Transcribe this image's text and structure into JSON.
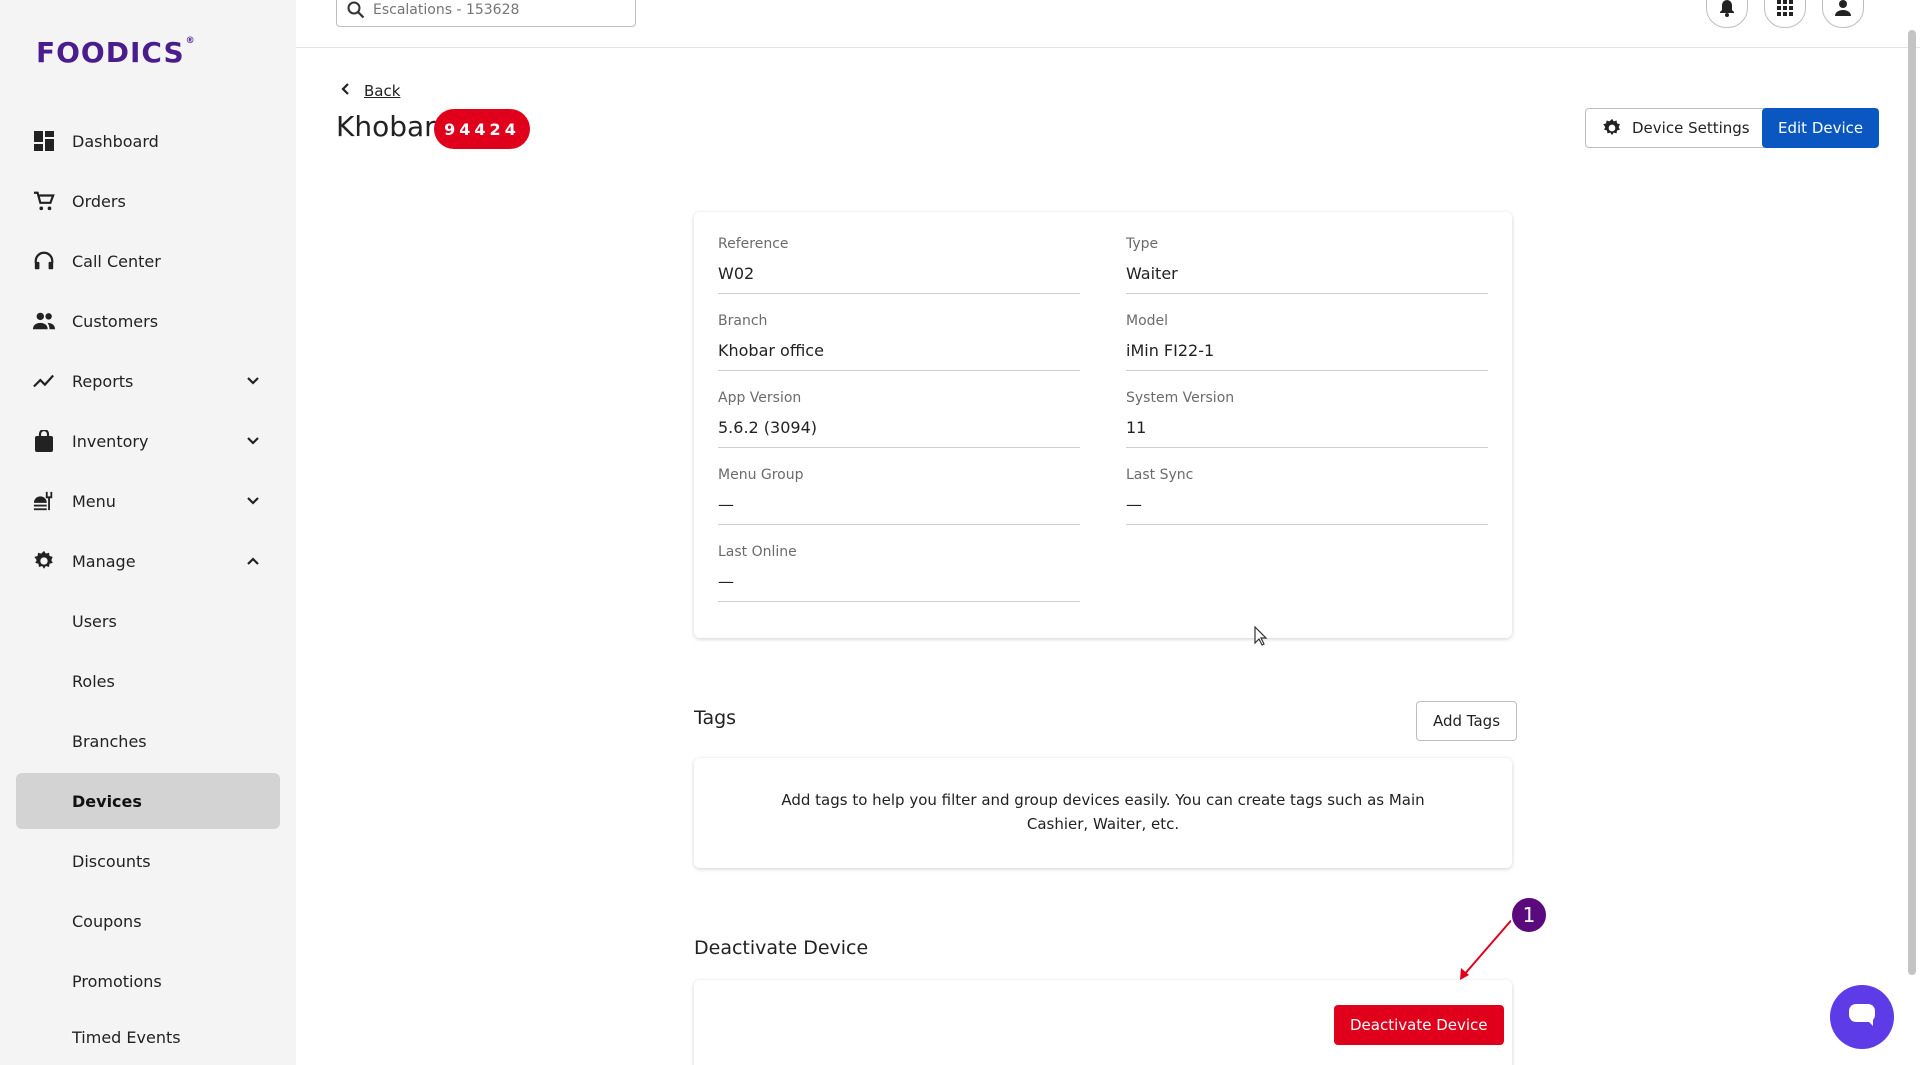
{
  "brand": {
    "logo": "FOODICS",
    "mark": "®",
    "color": "#4a1c8c"
  },
  "sidebar": {
    "items": [
      {
        "label": "Dashboard",
        "icon": "dashboard-icon"
      },
      {
        "label": "Orders",
        "icon": "cart-icon"
      },
      {
        "label": "Call Center",
        "icon": "headset-icon"
      },
      {
        "label": "Customers",
        "icon": "customers-icon"
      },
      {
        "label": "Reports",
        "icon": "reports-icon",
        "expandable": true
      },
      {
        "label": "Inventory",
        "icon": "inventory-icon",
        "expandable": true
      },
      {
        "label": "Menu",
        "icon": "menu-icon",
        "expandable": true
      },
      {
        "label": "Manage",
        "icon": "gear-icon",
        "expanded": true
      }
    ],
    "manage_items": [
      "Users",
      "Roles",
      "Branches",
      "Devices",
      "Discounts",
      "Coupons",
      "Promotions",
      "Timed Events"
    ],
    "active": "Devices"
  },
  "topbar": {
    "search_placeholder": "Escalations - 153628",
    "icons": [
      "bell-icon",
      "apps-grid-icon",
      "user-icon"
    ]
  },
  "header": {
    "back_label": "Back",
    "title": "Khobar",
    "reference_badge": "94424",
    "device_settings_label": "Device Settings",
    "edit_device_label": "Edit Device"
  },
  "details": {
    "reference": {
      "label": "Reference",
      "value": "W02"
    },
    "type": {
      "label": "Type",
      "value": "Waiter"
    },
    "branch": {
      "label": "Branch",
      "value": "Khobar office"
    },
    "model": {
      "label": "Model",
      "value": "iMin FI22-1"
    },
    "app_version": {
      "label": "App Version",
      "value": "5.6.2 (3094)"
    },
    "system_version": {
      "label": "System Version",
      "value": "11"
    },
    "menu_group": {
      "label": "Menu Group",
      "value": "—"
    },
    "last_sync": {
      "label": "Last Sync",
      "value": "—"
    },
    "last_online": {
      "label": "Last Online",
      "value": "—"
    }
  },
  "tags": {
    "title": "Tags",
    "add_label": "Add Tags",
    "empty_text": "Add tags to help you filter and group devices easily. You can create tags such as Main Cashier, Waiter, etc."
  },
  "deactivate": {
    "title": "Deactivate Device",
    "button_label": "Deactivate Device"
  },
  "annotation": {
    "step": "1",
    "color": "#5b0a7e",
    "arrow_color": "#e0001b"
  },
  "colors": {
    "primary": "#0a57c2",
    "danger": "#e0001b",
    "chat": "#5d3be6",
    "active_nav": "#d3d3d3"
  }
}
